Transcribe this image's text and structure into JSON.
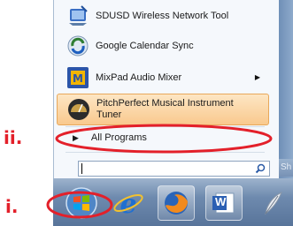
{
  "annotations": {
    "label_ii": "ii.",
    "label_i": "i."
  },
  "start_menu": {
    "items": [
      {
        "label": "SDUSD Wireless Network Tool",
        "icon": "wireless-tool-icon"
      },
      {
        "label": "Google Calendar Sync",
        "icon": "calendar-sync-icon"
      },
      {
        "label": "MixPad Audio Mixer",
        "icon": "mixpad-icon",
        "has_submenu": true
      },
      {
        "label_line1": "PitchPerfect Musical Instrument",
        "label_line2": "Tuner",
        "icon": "tuner-icon",
        "highlighted": true
      }
    ],
    "all_programs": "All Programs",
    "search_value": "",
    "side_button_text": "Sh"
  },
  "taskbar": {
    "buttons": [
      {
        "name": "start-orb",
        "icon": "windows-logo-icon"
      },
      {
        "name": "internet-explorer",
        "icon": "ie-icon"
      },
      {
        "name": "firefox",
        "icon": "firefox-icon"
      },
      {
        "name": "word",
        "icon": "word-icon",
        "text": "W"
      },
      {
        "name": "extra",
        "icon": "feather-icon"
      }
    ]
  },
  "colors": {
    "annotation_red": "#e3202a",
    "highlight": "#f9c98e",
    "taskbar": "#6e8aae"
  }
}
